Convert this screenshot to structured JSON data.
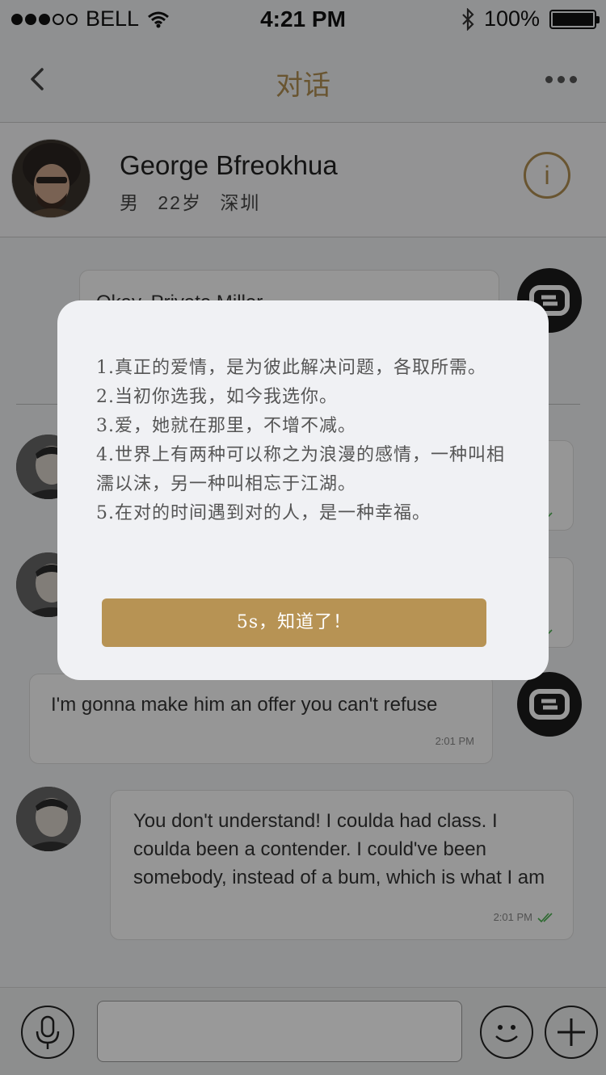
{
  "status_bar": {
    "carrier": "BELL",
    "time": "4:21 PM",
    "battery": "100%"
  },
  "nav": {
    "title": "对话"
  },
  "profile": {
    "name": "George Bfreokhua",
    "gender": "男",
    "age": "22岁",
    "city": "深圳",
    "info_glyph": "i"
  },
  "messages": [
    {
      "side": "right",
      "text": "Okay, Private Miller"
    },
    {
      "side": "left",
      "text": "",
      "time": ""
    },
    {
      "side": "left",
      "text": "",
      "time": ""
    },
    {
      "side": "right",
      "text": "I'm gonna make him an offer you can't refuse",
      "time": "2:01 PM"
    },
    {
      "side": "left",
      "text": "You don't understand! I coulda had class. I coulda been a contender. I could've been somebody, instead of a bum, which is what I am",
      "time": "2:01 PM"
    }
  ],
  "dialog": {
    "lines": [
      "1.真正的爱情，是为彼此解决问题，各取所需。",
      "2.当初你选我，如今我选你。",
      "3.爱，她就在那里，不增不减。",
      "4.世界上有两种可以称之为浪漫的感情，一种叫相濡以沫，另一种叫相忘于江湖。",
      "5.在对的时间遇到对的人，是一种幸福。"
    ],
    "button_label": "5s，知道了！"
  },
  "colors": {
    "accent": "#b08e52",
    "button": "#b79354",
    "read_check": "#4caf50"
  },
  "icons": [
    "back-chevron-icon",
    "more-dots-icon",
    "info-icon",
    "mic-icon",
    "emoji-icon",
    "plus-icon",
    "read-check-icon",
    "wifi-icon",
    "bluetooth-icon",
    "battery-icon"
  ]
}
